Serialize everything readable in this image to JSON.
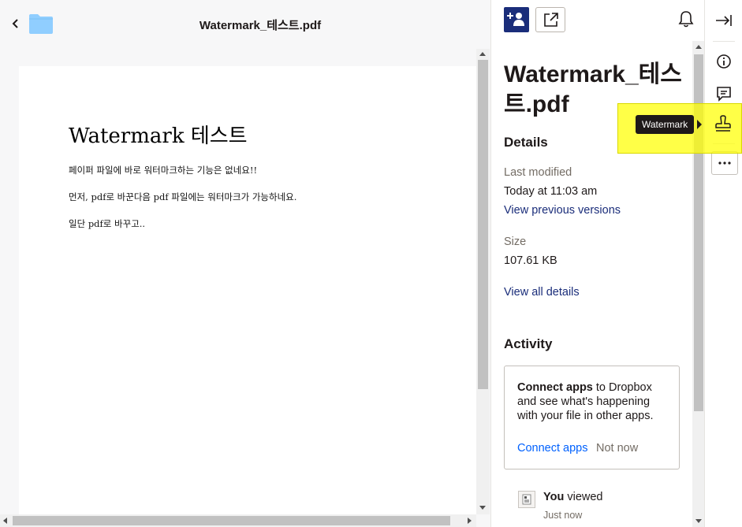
{
  "viewer": {
    "title": "Watermark_테스트.pdf",
    "document": {
      "heading": "Watermark 테스트",
      "paragraphs": [
        "페이퍼 파일에 바로 워터마크하는 기능은 없네요!!",
        "먼저, pdf로 바꾼다음 pdf 파일에는 워터마크가 가능하네요.",
        "일단 pdf로 바꾸고.."
      ]
    }
  },
  "panel": {
    "file_title": "Watermark_테스트.pdf",
    "details": {
      "heading": "Details",
      "last_modified_label": "Last modified",
      "last_modified_value": "Today at 11:03 am",
      "view_versions_link": "View previous versions",
      "size_label": "Size",
      "size_value": "107.61 KB",
      "view_details_link": "View all details"
    },
    "activity": {
      "heading": "Activity",
      "connect_bold": "Connect apps",
      "connect_rest": " to Dropbox and see what's happening with your file in other apps.",
      "connect_link": "Connect apps",
      "not_now_link": "Not now",
      "item_actor": "You",
      "item_action": " viewed",
      "item_time": "Just now"
    }
  },
  "rail": {
    "tooltip": "Watermark"
  },
  "colors": {
    "accent_navy": "#1a2d7a",
    "link_blue": "#0061fe",
    "highlight": "#ffff00",
    "folder_blue": "#90ceff"
  }
}
